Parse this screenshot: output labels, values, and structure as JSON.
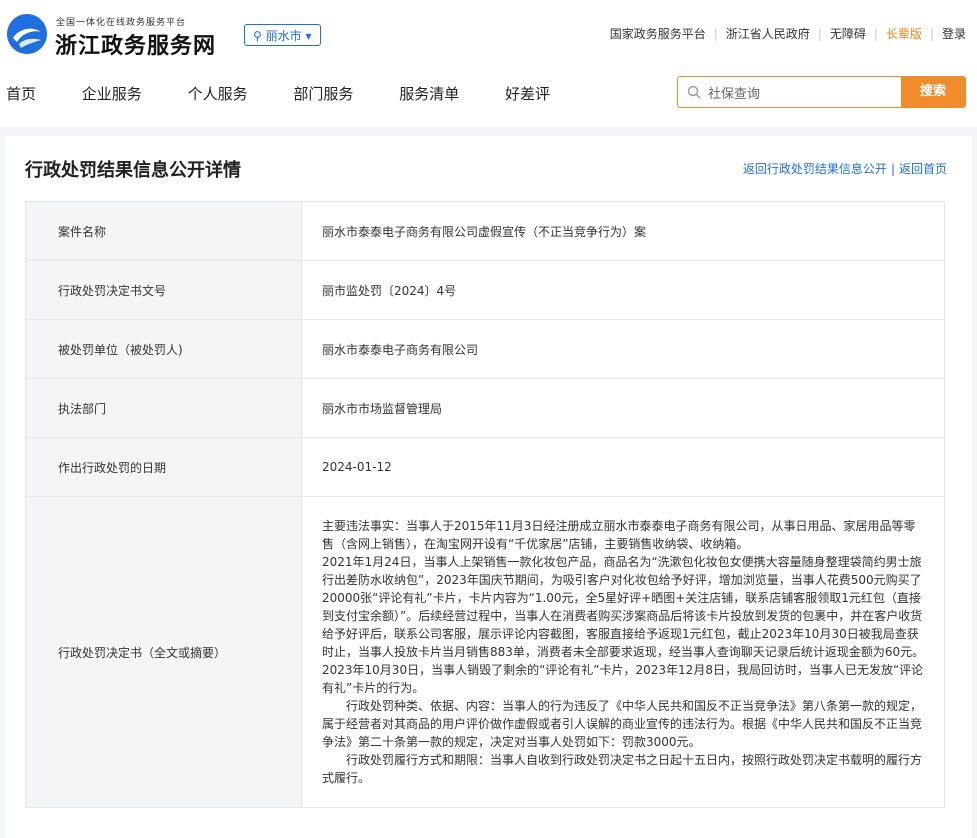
{
  "header": {
    "logo_sub": "全国一体化在线政务服务平台",
    "logo_title": "浙江政务服务网",
    "city": "丽水市",
    "links": [
      "国家政务服务平台",
      "浙江省人民政府",
      "无障碍",
      "长辈版",
      "登录"
    ]
  },
  "nav": {
    "items": [
      "首页",
      "企业服务",
      "个人服务",
      "部门服务",
      "服务清单",
      "好差评"
    ]
  },
  "search": {
    "value": "社保查询",
    "button": "搜索"
  },
  "page": {
    "title": "行政处罚结果信息公开详情",
    "back_link": "返回行政处罚结果信息公开",
    "home_link": "返回首页"
  },
  "rows": [
    {
      "label": "案件名称",
      "value": "丽水市泰泰电子商务有限公司虚假宣传（不正当竞争行为）案"
    },
    {
      "label": "行政处罚决定书文号",
      "value": "丽市监处罚〔2024〕4号"
    },
    {
      "label": "被处罚单位（被处罚人)",
      "value": "丽水市泰泰电子商务有限公司"
    },
    {
      "label": "执法部门",
      "value": "丽水市市场监督管理局"
    },
    {
      "label": "作出行政处罚的日期",
      "value": "2024-01-12"
    }
  ],
  "decision": {
    "label": "行政处罚决定书（全文或摘要）",
    "paragraphs": [
      "主要违法事实：当事人于2015年11月3日经注册成立丽水市泰泰电子商务有限公司，从事日用品、家居用品等零售（含网上销售），在淘宝网开设有“千优家居”店铺，主要销售收纳袋、收纳箱。",
      "2021年1月24日，当事人上架销售一款化妆包产品，商品名为“洗漱包化妆包女便携大容量随身整理袋简约男士旅行出差防水收纳包”，2023年国庆节期间，为吸引客户对化妆包给予好评，增加浏览量，当事人花费500元购买了20000张“评论有礼”卡片，卡片内容为“1.00元，全5星好评+晒图+关注店铺，联系店铺客服领取1元红包（直接到支付宝余额）”。后续经营过程中，当事人在消费者购买涉案商品后将该卡片投放到发货的包裹中，并在客户收货给予好评后，联系公司客服，展示评论内容截图，客服直接给予返现1元红包，截止2023年10月30日被我局查获时止，当事人投放卡片当月销售883单，消费者未全部要求返现，经当事人查询聊天记录后统计返现金额为60元。",
      "2023年10月30日，当事人销毁了剩余的“评论有礼”卡片，2023年12月8日，我局回访时，当事人已无发放“评论有礼”卡片的行为。",
      "行政处罚种类、依据、内容：当事人的行为违反了《中华人民共和国反不正当竞争法》第八条第一款的规定，属于经营者对其商品的用户评价做作虚假或者引人误解的商业宣传的违法行为。根据《中华人民共和国反不正当竞争法》第二十条第一款的规定，决定对当事人处罚如下：罚款3000元。",
      "行政处罚履行方式和期限：当事人自收到行政处罚决定书之日起十五日内，按照行政处罚决定书载明的履行方式履行。"
    ]
  },
  "colors": {
    "brand_blue": "#1f6fe0",
    "accent_orange": "#f08c2b"
  }
}
